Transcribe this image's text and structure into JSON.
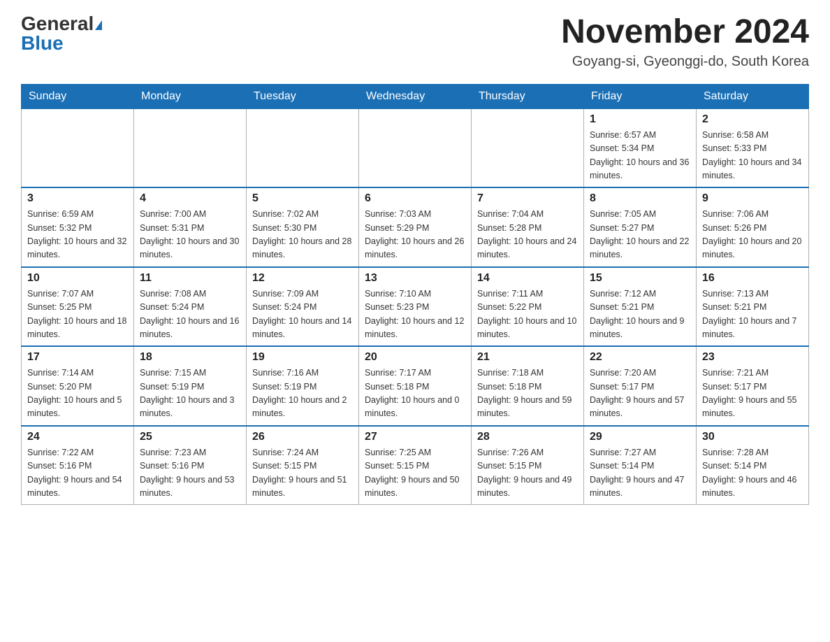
{
  "header": {
    "logo_general": "General",
    "logo_blue": "Blue",
    "month_title": "November 2024",
    "location": "Goyang-si, Gyeonggi-do, South Korea"
  },
  "days_of_week": [
    "Sunday",
    "Monday",
    "Tuesday",
    "Wednesday",
    "Thursday",
    "Friday",
    "Saturday"
  ],
  "weeks": [
    [
      {
        "day": "",
        "info": ""
      },
      {
        "day": "",
        "info": ""
      },
      {
        "day": "",
        "info": ""
      },
      {
        "day": "",
        "info": ""
      },
      {
        "day": "",
        "info": ""
      },
      {
        "day": "1",
        "info": "Sunrise: 6:57 AM\nSunset: 5:34 PM\nDaylight: 10 hours and 36 minutes."
      },
      {
        "day": "2",
        "info": "Sunrise: 6:58 AM\nSunset: 5:33 PM\nDaylight: 10 hours and 34 minutes."
      }
    ],
    [
      {
        "day": "3",
        "info": "Sunrise: 6:59 AM\nSunset: 5:32 PM\nDaylight: 10 hours and 32 minutes."
      },
      {
        "day": "4",
        "info": "Sunrise: 7:00 AM\nSunset: 5:31 PM\nDaylight: 10 hours and 30 minutes."
      },
      {
        "day": "5",
        "info": "Sunrise: 7:02 AM\nSunset: 5:30 PM\nDaylight: 10 hours and 28 minutes."
      },
      {
        "day": "6",
        "info": "Sunrise: 7:03 AM\nSunset: 5:29 PM\nDaylight: 10 hours and 26 minutes."
      },
      {
        "day": "7",
        "info": "Sunrise: 7:04 AM\nSunset: 5:28 PM\nDaylight: 10 hours and 24 minutes."
      },
      {
        "day": "8",
        "info": "Sunrise: 7:05 AM\nSunset: 5:27 PM\nDaylight: 10 hours and 22 minutes."
      },
      {
        "day": "9",
        "info": "Sunrise: 7:06 AM\nSunset: 5:26 PM\nDaylight: 10 hours and 20 minutes."
      }
    ],
    [
      {
        "day": "10",
        "info": "Sunrise: 7:07 AM\nSunset: 5:25 PM\nDaylight: 10 hours and 18 minutes."
      },
      {
        "day": "11",
        "info": "Sunrise: 7:08 AM\nSunset: 5:24 PM\nDaylight: 10 hours and 16 minutes."
      },
      {
        "day": "12",
        "info": "Sunrise: 7:09 AM\nSunset: 5:24 PM\nDaylight: 10 hours and 14 minutes."
      },
      {
        "day": "13",
        "info": "Sunrise: 7:10 AM\nSunset: 5:23 PM\nDaylight: 10 hours and 12 minutes."
      },
      {
        "day": "14",
        "info": "Sunrise: 7:11 AM\nSunset: 5:22 PM\nDaylight: 10 hours and 10 minutes."
      },
      {
        "day": "15",
        "info": "Sunrise: 7:12 AM\nSunset: 5:21 PM\nDaylight: 10 hours and 9 minutes."
      },
      {
        "day": "16",
        "info": "Sunrise: 7:13 AM\nSunset: 5:21 PM\nDaylight: 10 hours and 7 minutes."
      }
    ],
    [
      {
        "day": "17",
        "info": "Sunrise: 7:14 AM\nSunset: 5:20 PM\nDaylight: 10 hours and 5 minutes."
      },
      {
        "day": "18",
        "info": "Sunrise: 7:15 AM\nSunset: 5:19 PM\nDaylight: 10 hours and 3 minutes."
      },
      {
        "day": "19",
        "info": "Sunrise: 7:16 AM\nSunset: 5:19 PM\nDaylight: 10 hours and 2 minutes."
      },
      {
        "day": "20",
        "info": "Sunrise: 7:17 AM\nSunset: 5:18 PM\nDaylight: 10 hours and 0 minutes."
      },
      {
        "day": "21",
        "info": "Sunrise: 7:18 AM\nSunset: 5:18 PM\nDaylight: 9 hours and 59 minutes."
      },
      {
        "day": "22",
        "info": "Sunrise: 7:20 AM\nSunset: 5:17 PM\nDaylight: 9 hours and 57 minutes."
      },
      {
        "day": "23",
        "info": "Sunrise: 7:21 AM\nSunset: 5:17 PM\nDaylight: 9 hours and 55 minutes."
      }
    ],
    [
      {
        "day": "24",
        "info": "Sunrise: 7:22 AM\nSunset: 5:16 PM\nDaylight: 9 hours and 54 minutes."
      },
      {
        "day": "25",
        "info": "Sunrise: 7:23 AM\nSunset: 5:16 PM\nDaylight: 9 hours and 53 minutes."
      },
      {
        "day": "26",
        "info": "Sunrise: 7:24 AM\nSunset: 5:15 PM\nDaylight: 9 hours and 51 minutes."
      },
      {
        "day": "27",
        "info": "Sunrise: 7:25 AM\nSunset: 5:15 PM\nDaylight: 9 hours and 50 minutes."
      },
      {
        "day": "28",
        "info": "Sunrise: 7:26 AM\nSunset: 5:15 PM\nDaylight: 9 hours and 49 minutes."
      },
      {
        "day": "29",
        "info": "Sunrise: 7:27 AM\nSunset: 5:14 PM\nDaylight: 9 hours and 47 minutes."
      },
      {
        "day": "30",
        "info": "Sunrise: 7:28 AM\nSunset: 5:14 PM\nDaylight: 9 hours and 46 minutes."
      }
    ]
  ]
}
